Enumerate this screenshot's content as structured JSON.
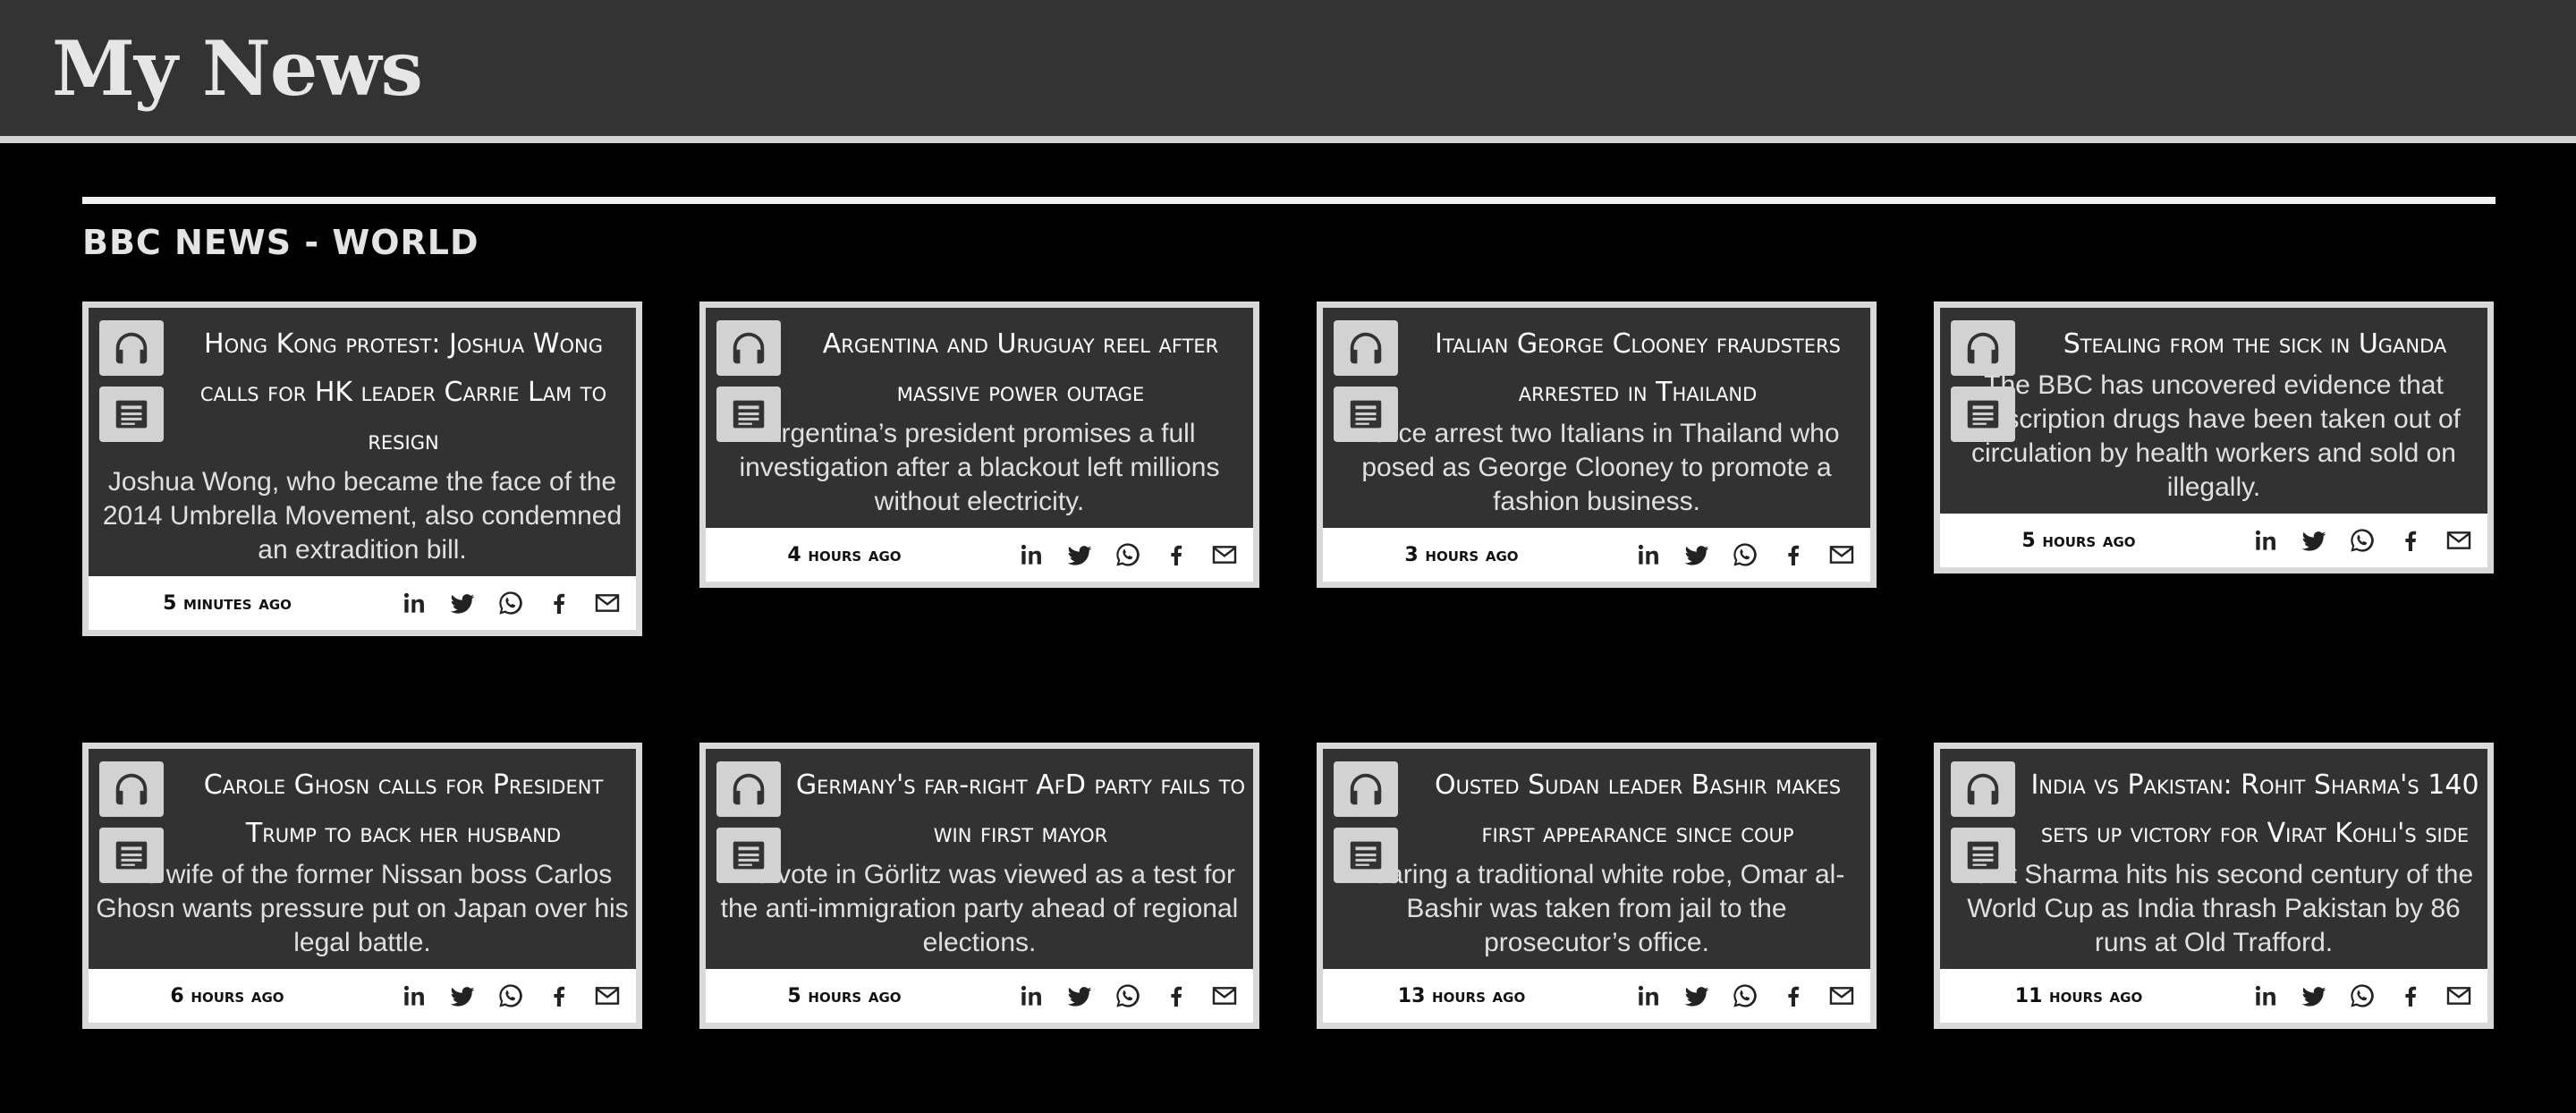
{
  "app": {
    "title": "My News"
  },
  "section": {
    "title": "BBC News - World"
  },
  "share_icons": [
    "linkedin-icon",
    "twitter-icon",
    "whatsapp-icon",
    "facebook-icon",
    "email-icon"
  ],
  "articles": [
    {
      "title": "Hong Kong protest: Joshua Wong calls for HK leader Carrie Lam to resign",
      "summary": "Joshua Wong, who became the face of the 2014 Umbrella Movement, also condemned an extradition bill.",
      "time": "5 minutes ago"
    },
    {
      "title": "Argentina and Uruguay reel after massive power outage",
      "summary": "Argentina’s president promises a full investigation after a blackout left millions without electricity.",
      "time": "4 hours ago"
    },
    {
      "title": "Italian George Clooney fraudsters arrested in Thailand",
      "summary": "Police arrest two Italians in Thailand who posed as George Clooney to promote a fashion business.",
      "time": "3 hours ago"
    },
    {
      "title": "Stealing from the sick in Uganda",
      "summary": "The BBC has uncovered evidence that prescription drugs have been taken out of circulation by health workers and sold on illegally.",
      "time": "5 hours ago"
    },
    {
      "title": "Carole Ghosn calls for President Trump to back her husband",
      "summary": "The wife of the former Nissan boss Carlos Ghosn wants pressure put on Japan over his legal battle.",
      "time": "6 hours ago"
    },
    {
      "title": "Germany's far-right AfD party fails to win first mayor",
      "summary": "The vote in Görlitz was viewed as a test for the anti-immigration party ahead of regional elections.",
      "time": "5 hours ago"
    },
    {
      "title": "Ousted Sudan leader Bashir makes first appearance since coup",
      "summary": "Wearing a traditional white robe, Omar al-Bashir was taken from jail to the prosecutor’s office.",
      "time": "13 hours ago"
    },
    {
      "title": "India vs Pakistan: Rohit Sharma's 140 sets up victory for Virat Kohli's side",
      "summary": "Rohit Sharma hits his second century of the World Cup as India thrash Pakistan by 86 runs at Old Trafford.",
      "time": "11 hours ago"
    }
  ]
}
